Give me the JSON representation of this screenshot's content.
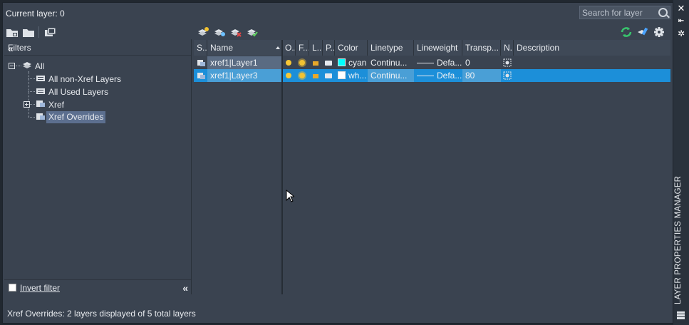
{
  "window": {
    "vertical_title": "LAYER PROPERTIES MANAGER",
    "buttons": [
      "close-icon",
      "pin-icon",
      "settings-icon"
    ]
  },
  "header": {
    "current_layer": "Current layer: 0",
    "search_placeholder": "Search for layer"
  },
  "filters": {
    "title": "Filters",
    "items": [
      {
        "label": "All"
      },
      {
        "label": "All non-Xref Layers"
      },
      {
        "label": "All Used Layers"
      },
      {
        "label": "Xref"
      },
      {
        "label": "Xref Overrides",
        "selected": true
      }
    ],
    "invert_filter_label": "Invert filter"
  },
  "grid": {
    "columns": [
      "S..",
      "Name",
      "O..",
      "F...",
      "L...",
      "P...",
      "Color",
      "Linetype",
      "Lineweight",
      "Transp...",
      "N..",
      "Description"
    ],
    "rows": [
      {
        "name": "xref1|Layer1",
        "color_name": "cyan",
        "color_hex": "#00ffff",
        "linetype": "Continu...",
        "lineweight": "Defa...",
        "transparency": "0",
        "selected": false
      },
      {
        "name": "xref1|Layer3",
        "color_name": "wh...",
        "color_hex": "#ffffff",
        "linetype": "Continu...",
        "lineweight": "Defa...",
        "transparency": "80",
        "selected": true
      }
    ]
  },
  "status": {
    "text": "Xref Overrides: 2 layers displayed of 5 total layers"
  },
  "colors": {
    "selection": "#1c8fd9",
    "row_hover": "#5b6b80",
    "panel": "#3a4350"
  }
}
